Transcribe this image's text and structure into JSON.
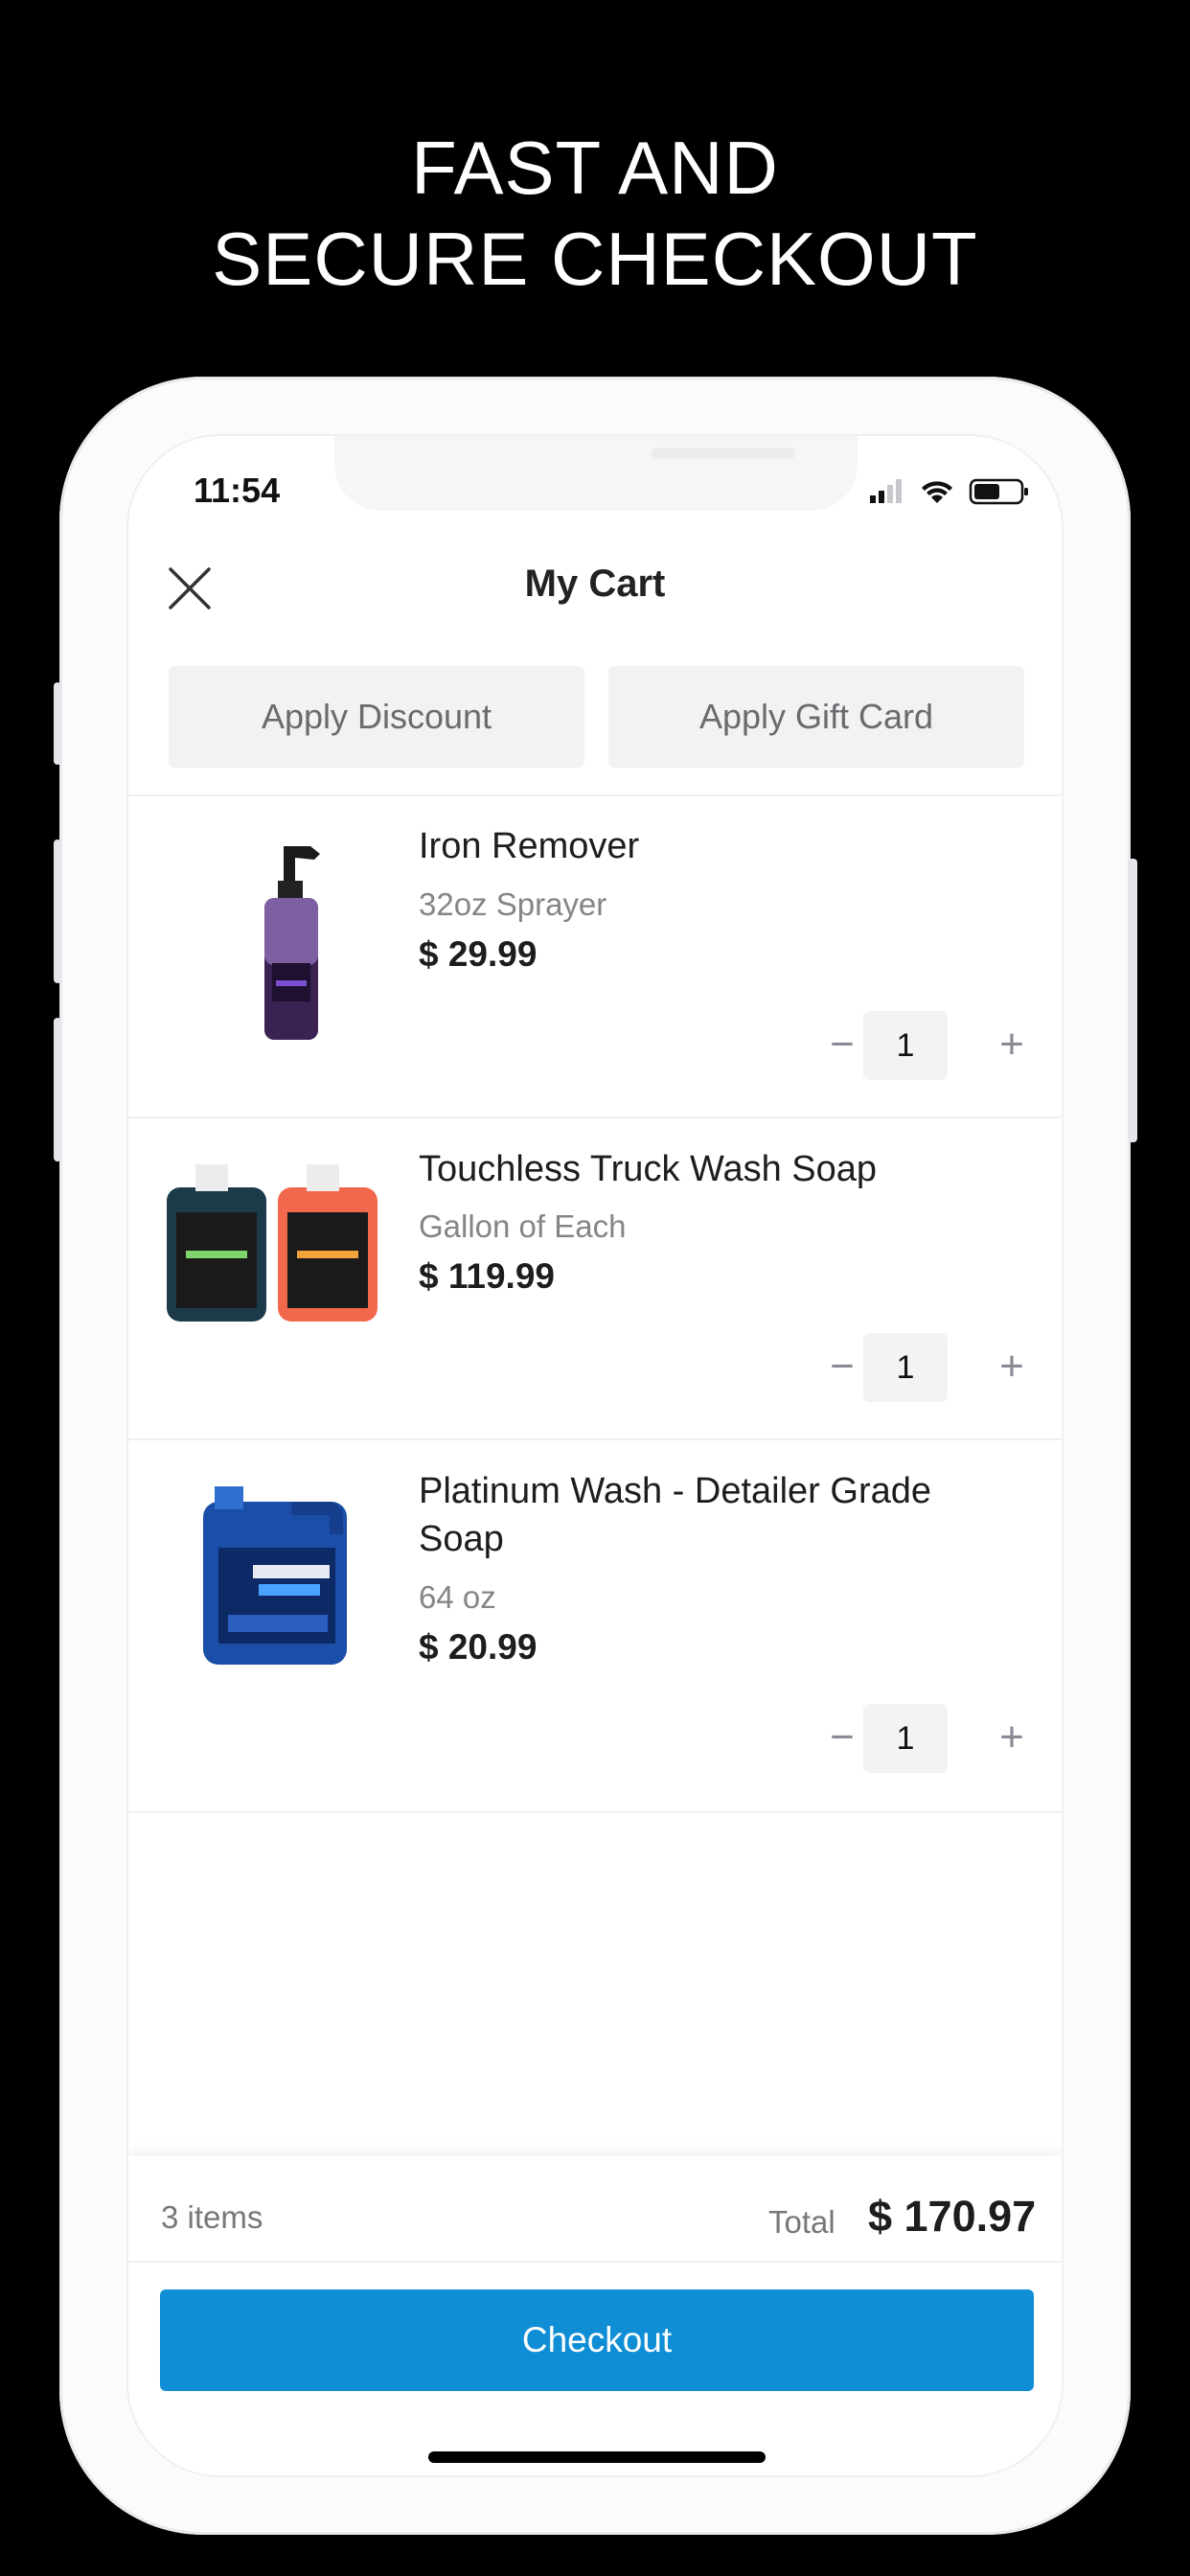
{
  "headline": {
    "line1": "FAST AND",
    "line2": "SECURE CHECKOUT"
  },
  "status_bar": {
    "time": "11:54"
  },
  "header": {
    "title": "My Cart",
    "close_icon": "close-icon"
  },
  "actions": {
    "discount_label": "Apply Discount",
    "gift_card_label": "Apply Gift Card"
  },
  "cart_items": [
    {
      "name": "Iron Remover",
      "variant": "32oz Sprayer",
      "price": "$ 29.99",
      "quantity": "1"
    },
    {
      "name": "Touchless Truck Wash Soap",
      "variant": "Gallon of Each",
      "price": "$ 119.99",
      "quantity": "1"
    },
    {
      "name": "Platinum Wash - Detailer Grade Soap",
      "variant": "64 oz",
      "price": "$ 20.99",
      "quantity": "1"
    }
  ],
  "summary": {
    "items_count": "3 items",
    "total_label": "Total",
    "total_value": "$ 170.97"
  },
  "checkout": {
    "label": "Checkout"
  },
  "colors": {
    "accent": "#0f8ed6",
    "background": "#000000"
  }
}
